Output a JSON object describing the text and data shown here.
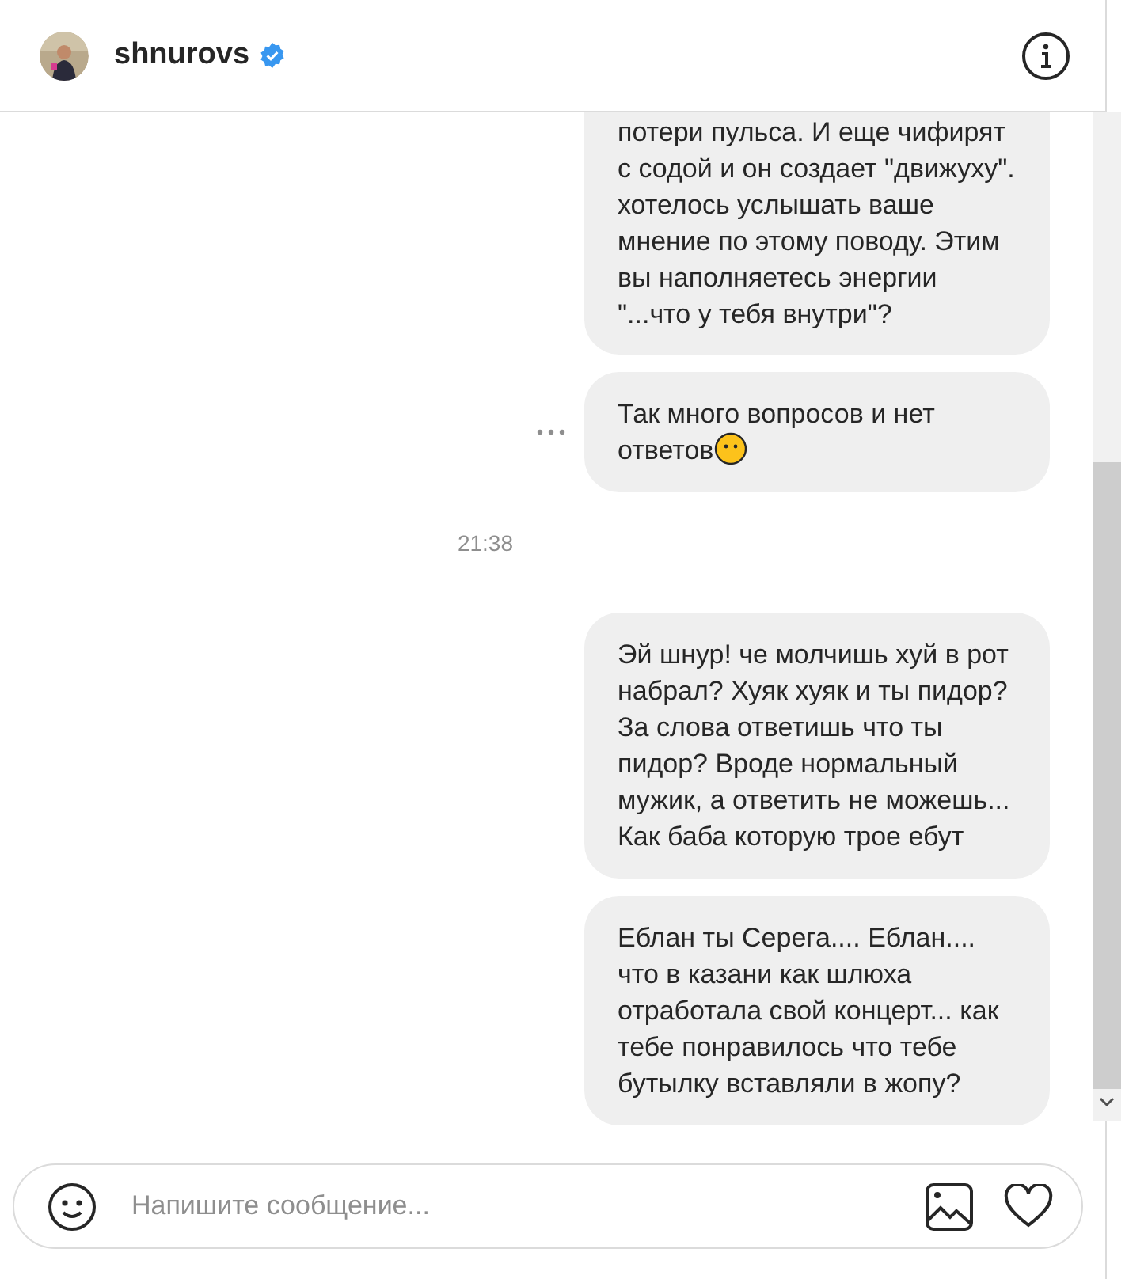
{
  "header": {
    "username": "shnurovs",
    "verified": true
  },
  "messages": [
    {
      "kind": "bubble",
      "text": "потери пульса. И еще чифирят с содой и он создает \"движуху\". хотелось услышать ваше мнение по этому поводу. Этим вы наполняетесь энергии \"...что у тебя внутри\"?",
      "cut_top": true
    },
    {
      "kind": "bubble",
      "text": "Так много вопросов и нет ответов",
      "emoji": true,
      "more": true
    },
    {
      "kind": "time",
      "text": "21:38"
    },
    {
      "kind": "bubble",
      "text": "Эй шнур! че молчишь хуй в рот набрал? Хуяк хуяк и ты пидор? За слова ответишь что ты пидор? Вроде нормальный мужик, а ответить не можешь... Как баба которую трое ебут"
    },
    {
      "kind": "bubble",
      "text": "Еблан ты Серега.... Еблан.... что в казани как шлюха отработала свой концерт... как тебе понравилось что тебе бутылку вставляли в жопу?"
    }
  ],
  "composer": {
    "placeholder": "Напишите сообщение..."
  }
}
